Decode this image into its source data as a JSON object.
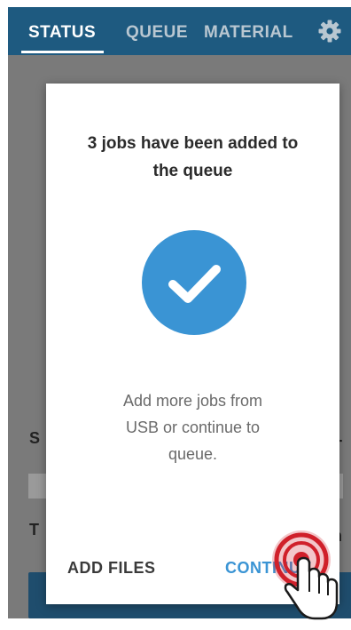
{
  "header": {
    "tabs": [
      {
        "label": "STATUS",
        "active": true
      },
      {
        "label": "QUEUE",
        "active": false
      },
      {
        "label": "MATERIAL",
        "active": false
      }
    ],
    "settings_icon": "gear-icon"
  },
  "background": {
    "left_initials": [
      "S",
      "T"
    ],
    "right_initials": [
      "T",
      "n"
    ]
  },
  "modal": {
    "title_line1": "3 jobs have been added to",
    "title_line2": "the queue",
    "status_icon": "check-icon",
    "message_line1": "Add more jobs from",
    "message_line2": "USB or continue to",
    "message_line3": "queue.",
    "add_files_label": "ADD FILES",
    "continue_label": "CONTINUE"
  },
  "colors": {
    "topbar": "#1e5a80",
    "accent": "#3a94d4",
    "overlay": "#7a7a7a",
    "tap_indicator": "#d0202a"
  },
  "overlay": {
    "tap_indicator_icon": "hand-pointer-icon"
  }
}
